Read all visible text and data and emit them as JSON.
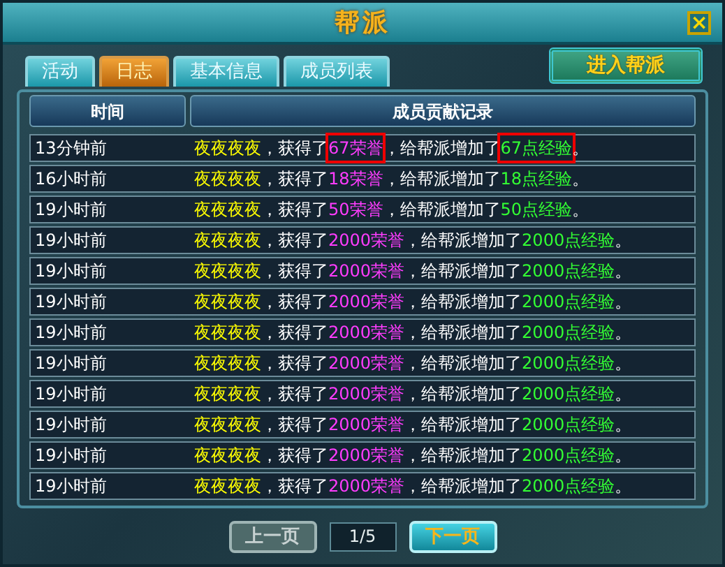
{
  "window": {
    "title": "帮派",
    "close": "×"
  },
  "tabs": [
    {
      "label": "活动",
      "selected": false
    },
    {
      "label": "日志",
      "selected": true
    },
    {
      "label": "基本信息",
      "selected": false
    },
    {
      "label": "成员列表",
      "selected": false
    }
  ],
  "join_button": "进入帮派",
  "table": {
    "columns": [
      "时间",
      "成员贡献记录"
    ],
    "rows": [
      {
        "time": "13分钟前",
        "name": "夜夜夜夜",
        "verb": "，获得了",
        "honor": "67荣誉",
        "mid": "，给帮派增加了",
        "exp": "67点经验",
        "end": "。",
        "boxed": true
      },
      {
        "time": "16小时前",
        "name": "夜夜夜夜",
        "verb": "，获得了",
        "honor": "18荣誉",
        "mid": "，给帮派增加了",
        "exp": "18点经验",
        "end": "。",
        "boxed": false
      },
      {
        "time": "19小时前",
        "name": "夜夜夜夜",
        "verb": "，获得了",
        "honor": "50荣誉",
        "mid": "，给帮派增加了",
        "exp": "50点经验",
        "end": "。",
        "boxed": false
      },
      {
        "time": "19小时前",
        "name": "夜夜夜夜",
        "verb": "，获得了",
        "honor": "2000荣誉",
        "mid": "，给帮派增加了",
        "exp": "2000点经验",
        "end": "。",
        "boxed": false
      },
      {
        "time": "19小时前",
        "name": "夜夜夜夜",
        "verb": "，获得了",
        "honor": "2000荣誉",
        "mid": "，给帮派增加了",
        "exp": "2000点经验",
        "end": "。",
        "boxed": false
      },
      {
        "time": "19小时前",
        "name": "夜夜夜夜",
        "verb": "，获得了",
        "honor": "2000荣誉",
        "mid": "，给帮派增加了",
        "exp": "2000点经验",
        "end": "。",
        "boxed": false
      },
      {
        "time": "19小时前",
        "name": "夜夜夜夜",
        "verb": "，获得了",
        "honor": "2000荣誉",
        "mid": "，给帮派增加了",
        "exp": "2000点经验",
        "end": "。",
        "boxed": false
      },
      {
        "time": "19小时前",
        "name": "夜夜夜夜",
        "verb": "，获得了",
        "honor": "2000荣誉",
        "mid": "，给帮派增加了",
        "exp": "2000点经验",
        "end": "。",
        "boxed": false
      },
      {
        "time": "19小时前",
        "name": "夜夜夜夜",
        "verb": "，获得了",
        "honor": "2000荣誉",
        "mid": "，给帮派增加了",
        "exp": "2000点经验",
        "end": "。",
        "boxed": false
      },
      {
        "time": "19小时前",
        "name": "夜夜夜夜",
        "verb": "，获得了",
        "honor": "2000荣誉",
        "mid": "，给帮派增加了",
        "exp": "2000点经验",
        "end": "。",
        "boxed": false
      },
      {
        "time": "19小时前",
        "name": "夜夜夜夜",
        "verb": "，获得了",
        "honor": "2000荣誉",
        "mid": "，给帮派增加了",
        "exp": "2000点经验",
        "end": "。",
        "boxed": false
      },
      {
        "time": "19小时前",
        "name": "夜夜夜夜",
        "verb": "，获得了",
        "honor": "2000荣誉",
        "mid": "，给帮派增加了",
        "exp": "2000点经验",
        "end": "。",
        "boxed": false
      }
    ]
  },
  "pager": {
    "prev": {
      "label": "上一页",
      "disabled": true
    },
    "page": "1/5",
    "next": {
      "label": "下一页",
      "disabled": false
    }
  }
}
